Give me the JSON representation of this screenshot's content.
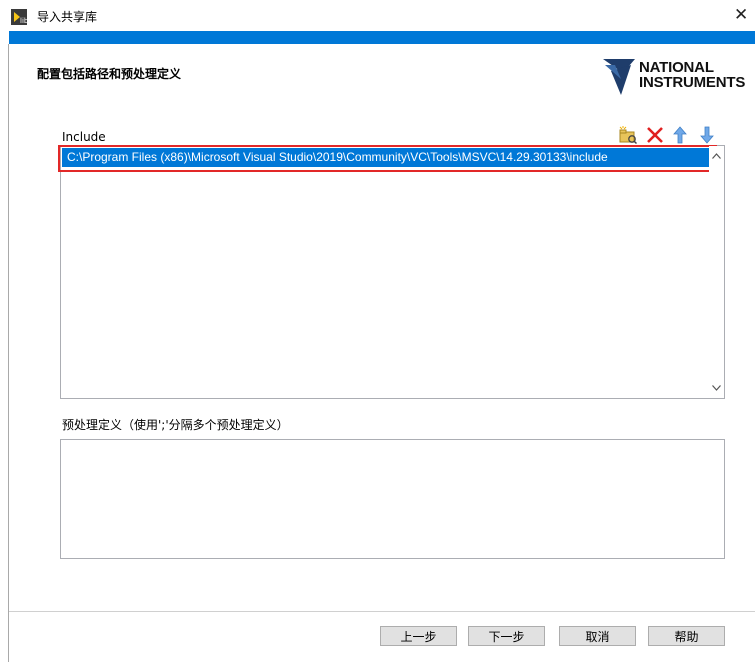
{
  "window": {
    "title": "导入共享库",
    "close_glyph": "✕"
  },
  "header": {
    "section_title": "配置包括路径和预处理定义",
    "logo": {
      "line1": "NATIONAL",
      "line2": "INSTRUMENTS"
    }
  },
  "include": {
    "label": "Include",
    "items": [
      "C:\\Program Files (x86)\\Microsoft Visual Studio\\2019\\Community\\VC\\Tools\\MSVC\\14.29.30133\\include"
    ],
    "toolbar_icons": [
      "new-path-folder-icon",
      "delete-x-icon",
      "move-up-arrow-icon",
      "move-down-arrow-icon"
    ]
  },
  "preprocessor": {
    "label": "预处理定义（使用';'分隔多个预处理定义）",
    "value": ""
  },
  "buttons": {
    "back": "上一步",
    "next": "下一步",
    "cancel": "取消",
    "help": "帮助"
  },
  "colors": {
    "accent": "#0078d7",
    "highlight_box": "#e22828",
    "delete_icon": "#e02020",
    "arrow_icon": "#6fa8e8"
  }
}
